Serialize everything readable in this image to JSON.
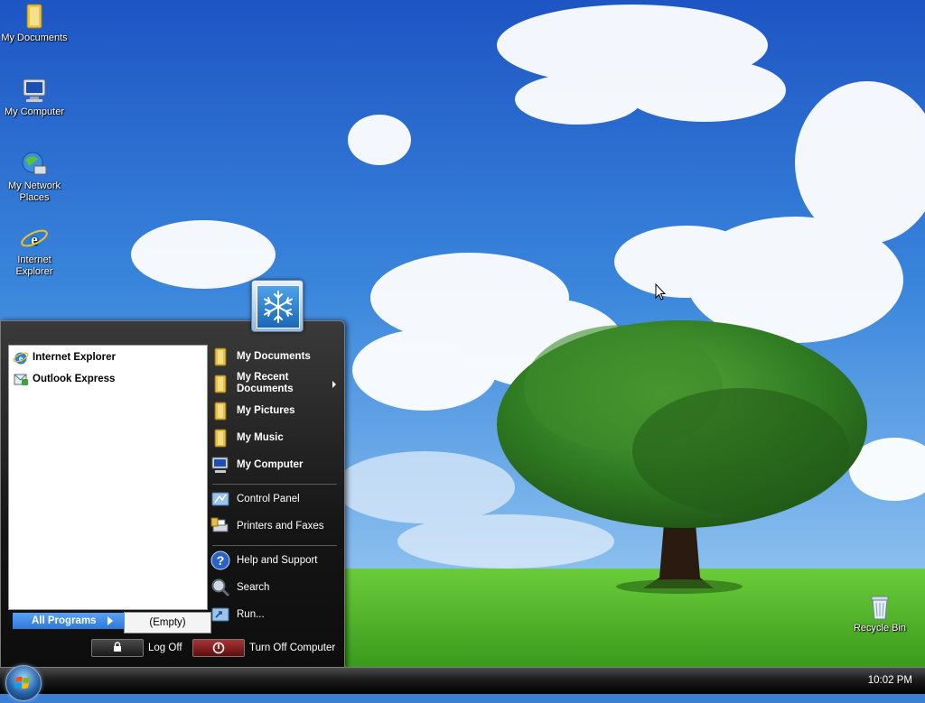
{
  "desktop": {
    "icons": [
      {
        "label": "My Documents",
        "icon": "my-documents-folder-icon"
      },
      {
        "label": "My Computer",
        "icon": "my-computer-icon"
      },
      {
        "label": "My Network Places",
        "icon": "network-places-icon"
      },
      {
        "label": "Internet Explorer",
        "icon": "internet-explorer-icon"
      },
      {
        "label": "Recycle Bin",
        "icon": "recycle-bin-icon"
      }
    ],
    "cursor": "arrow-cursor-icon"
  },
  "start_menu": {
    "user_picture": "snowflake-icon",
    "pinned": [
      {
        "label": "Internet Explorer",
        "icon": "internet-explorer-icon"
      },
      {
        "label": "Outlook Express",
        "icon": "outlook-express-icon"
      }
    ],
    "all_programs_label": "All Programs",
    "empty_label": "(Empty)",
    "right_items": [
      {
        "label": "My Documents",
        "icon": "folder-icon"
      },
      {
        "label": "My Recent Documents",
        "icon": "folder-icon"
      },
      {
        "label": "My Pictures",
        "icon": "folder-icon"
      },
      {
        "label": "My Music",
        "icon": "folder-icon"
      },
      {
        "label": "My Computer",
        "icon": "my-computer-icon"
      },
      {
        "label": "Control Panel",
        "icon": "control-panel-icon"
      },
      {
        "label": "Printers and Faxes",
        "icon": "printer-icon"
      },
      {
        "label": "Help and Support",
        "icon": "help-icon"
      },
      {
        "label": "Search",
        "icon": "search-icon"
      },
      {
        "label": "Run...",
        "icon": "run-icon"
      }
    ],
    "log_off_label": "Log Off",
    "turn_off_label": "Turn Off Computer"
  },
  "taskbar": {
    "start_icon": "windows-orb-icon",
    "clock": "10:02 PM"
  },
  "colors": {
    "sky": "#2a6fd0",
    "grass": "#4fb02a",
    "all_programs": "#3d8be8",
    "menu_dark": "#161616"
  }
}
